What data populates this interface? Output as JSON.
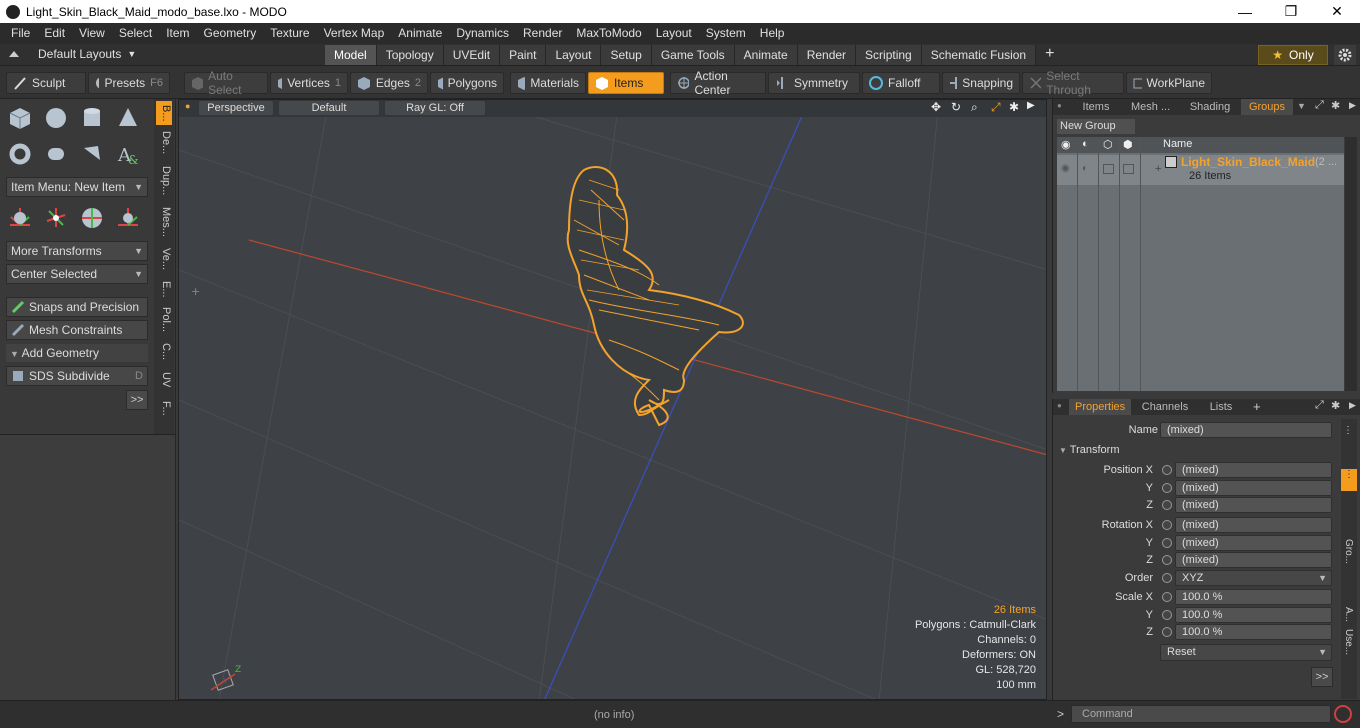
{
  "window": {
    "title": "Light_Skin_Black_Maid_modo_base.lxo - MODO",
    "minimize": "—",
    "maximize": "❐",
    "close": "✕"
  },
  "menu": [
    "File",
    "Edit",
    "View",
    "Select",
    "Item",
    "Geometry",
    "Texture",
    "Vertex Map",
    "Animate",
    "Dynamics",
    "Render",
    "MaxToModo",
    "Layout",
    "System",
    "Help"
  ],
  "layouts": {
    "label": "Default Layouts"
  },
  "tabs": [
    "Model",
    "Topology",
    "UVEdit",
    "Paint",
    "Layout",
    "Setup",
    "Game Tools",
    "Animate",
    "Render",
    "Scripting",
    "Schematic Fusion",
    "+"
  ],
  "active_tab": "Model",
  "only": {
    "label": "Only"
  },
  "toolbar": {
    "sculpt": "Sculpt",
    "presets": "Presets",
    "presets_key": "F6",
    "auto_select": "Auto Select",
    "vertices": "Vertices",
    "vertices_num": "1",
    "edges": "Edges",
    "edges_num": "2",
    "polygons": "Polygons",
    "materials": "Materials",
    "items": "Items",
    "action_center": "Action Center",
    "symmetry": "Symmetry",
    "falloff": "Falloff",
    "snapping": "Snapping",
    "select_through": "Select Through",
    "workplane": "WorkPlane"
  },
  "left": {
    "item_menu": "Item Menu: New Item",
    "more_transforms": "More Transforms",
    "center_selected": "Center Selected",
    "snaps": "Snaps and Precision",
    "mesh_constraints": "Mesh Constraints",
    "add_geometry": "Add Geometry",
    "sds": "SDS Subdivide",
    "sds_key": "D",
    "more": ">>",
    "vtabs": [
      "B...",
      "De...",
      "Dup...",
      "Mes...",
      "Ve...",
      "E...",
      "Pol...",
      "C...",
      "UV",
      "F..."
    ]
  },
  "viewport": {
    "view": "Perspective",
    "shading": "Default",
    "raygl": "Ray GL: Off",
    "stats": {
      "items": "26 Items",
      "polygons": "Polygons : Catmull-Clark",
      "channels": "Channels: 0",
      "deformers": "Deformers: ON",
      "gl": "GL: 528,720",
      "unit": "100 mm"
    }
  },
  "groups_panel": {
    "tabs": [
      "Items",
      "Mesh ...",
      "Shading",
      "Groups"
    ],
    "active": "Groups",
    "new_group": "New Group",
    "col_name": "Name",
    "group_name": "Light_Skin_Black_Maid",
    "group_suffix": "(2 ...",
    "group_count": "26 Items"
  },
  "properties": {
    "tabs": [
      "Properties",
      "Channels",
      "Lists",
      "+"
    ],
    "name_label": "Name",
    "name_value": "(mixed)",
    "transform": "Transform",
    "rows": [
      {
        "label": "Position X",
        "value": "(mixed)"
      },
      {
        "label": "Y",
        "value": "(mixed)"
      },
      {
        "label": "Z",
        "value": "(mixed)"
      },
      {
        "label": "Rotation X",
        "value": "(mixed)"
      },
      {
        "label": "Y",
        "value": "(mixed)"
      },
      {
        "label": "Z",
        "value": "(mixed)"
      },
      {
        "label": "Scale X",
        "value": "100.0 %"
      },
      {
        "label": "Y",
        "value": "100.0 %"
      },
      {
        "label": "Z",
        "value": "100.0 %"
      }
    ],
    "order_label": "Order",
    "order_value": "XYZ",
    "reset": "Reset",
    "more": ">>",
    "side_tabs": [
      "Gro...",
      "A...",
      "Use..."
    ]
  },
  "status": {
    "info": "(no info)",
    "command_placeholder": "Command"
  },
  "colors": {
    "accent": "#f39c1e",
    "mesh": "#f3a22c",
    "x_axis": "#c0472f",
    "z_axis": "#3a4fc0"
  }
}
